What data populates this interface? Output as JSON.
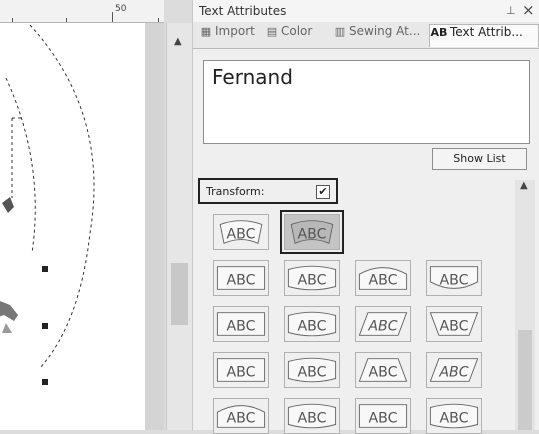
{
  "ruler": {
    "label": "50"
  },
  "panel": {
    "title": "Text Attributes",
    "pin_icon": "pin-icon",
    "close_icon": "close-icon",
    "tabs": [
      {
        "label": "Import",
        "icon": "import-icon"
      },
      {
        "label": "Color",
        "icon": "color-icon"
      },
      {
        "label": "Sewing At...",
        "icon": "sewing-icon"
      },
      {
        "label": "Text Attrib...",
        "icon": "text-attributes-icon"
      }
    ],
    "text_value": "Fernand",
    "show_list_label": "Show List",
    "transform": {
      "label": "Transform:",
      "checked": true
    },
    "transform_grid": {
      "rows": [
        [
          {
            "label": "ABC",
            "style": "arch-badge"
          },
          {
            "label": "ABC",
            "style": "arch-badge",
            "selected": true
          }
        ],
        [
          {
            "label": "ABC",
            "style": "plain"
          },
          {
            "label": "ABC",
            "style": "bulge"
          },
          {
            "label": "ABC",
            "style": "arch-up"
          },
          {
            "label": "ABC",
            "style": "arch-down"
          }
        ],
        [
          {
            "label": "ABC",
            "style": "plain"
          },
          {
            "label": "ABC",
            "style": "bulge"
          },
          {
            "label": "ABC",
            "style": "italic-slant"
          },
          {
            "label": "ABC",
            "style": "cone"
          }
        ],
        [
          {
            "label": "ABC",
            "style": "plain"
          },
          {
            "label": "ABC",
            "style": "bulge"
          },
          {
            "label": "ABC",
            "style": "cone-inv"
          },
          {
            "label": "ABC",
            "style": "italic-slant"
          }
        ],
        [
          {
            "label": "ABC",
            "style": "arch-up"
          },
          {
            "label": "ABC",
            "style": "bulge"
          },
          {
            "label": "ABC",
            "style": "plain"
          },
          {
            "label": "ABC",
            "style": "bulge"
          }
        ]
      ]
    }
  }
}
